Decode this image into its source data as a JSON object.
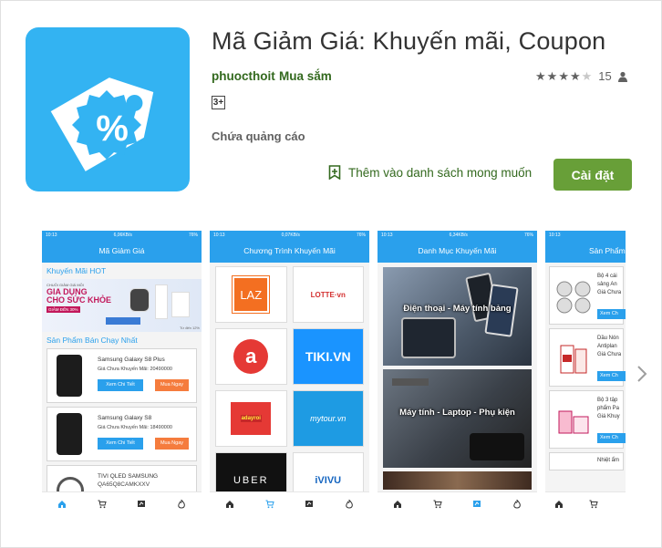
{
  "app": {
    "title": "Mã Giảm Giá: Khuyến mãi, Coupon",
    "developer": "phuocthoit",
    "category": "Mua sắm",
    "content_rating": "3+",
    "ads_notice": "Chứa quảng cáo",
    "rating_value": 4,
    "rating_max": 5,
    "rating_count": "15",
    "wishlist_label": "Thêm vào danh sách mong muốn",
    "install_label": "Cài đặt",
    "colors": {
      "accent": "#689f38",
      "link": "#33691e",
      "icon_bg": "#33b3f2",
      "app_bar": "#2aa0ec"
    }
  },
  "screenshots": {
    "status_time": "10:13",
    "s1": {
      "status_net": "6,06KB/s",
      "status_batt": "76%",
      "title": "Mã Giảm Giá",
      "section1": "Khuyến Mãi HOT",
      "banner_small": "CHUỖI GIẢM GIÁ MỖI",
      "banner_line1": "GIA DỤNG",
      "banner_line2": "CHO SỨC KHỎE",
      "banner_tag": "GIẢM ĐẾN 30%",
      "banner_corner": "Từ đến 12%",
      "section2": "Sản Phẩm Bán Chạy Nhất",
      "products": [
        {
          "name": "Samsung Galaxy S8 Plus",
          "price_label": "Giá Chưa Khuyến Mãi:",
          "price": "20490000",
          "detail": "Xem Chi Tiết",
          "buy": "Mua Ngay"
        },
        {
          "name": "Samsung Galaxy S8",
          "price_label": "Giá Chưa Khuyến Mãi:",
          "price": "18490000",
          "detail": "Xem Chi Tiết",
          "buy": "Mua Ngay"
        },
        {
          "name": "TIVI QLED SAMSUNG",
          "name2": "QA65Q8CAMKXXV"
        }
      ]
    },
    "s2": {
      "status_net": "0,07KB/s",
      "status_batt": "76%",
      "title": "Chương Trình Khuyến Mãi",
      "shops": [
        "LAZ",
        "LOTTE·vn",
        "a",
        "TIKI.VN",
        "adayroi",
        "mytour.vn",
        "UBER",
        "iVIVU"
      ]
    },
    "s3": {
      "status_net": "6,34KB/s",
      "status_batt": "76%",
      "title": "Danh Mục Khuyến Mãi",
      "categories": [
        "Điện thoại - Máy tính bảng",
        "Máy tính - Laptop - Phụ kiện"
      ]
    },
    "s4": {
      "title": "Sản Phẩm",
      "items": [
        {
          "l1": "Bộ 4 cái",
          "l2": "sảng An",
          "l3": "Giá Chưa",
          "btn": "Xem Ch"
        },
        {
          "l1": "Dầu Nón",
          "l2": "Antiplan",
          "l3": "Giá Chưa",
          "btn": "Xem Ch"
        },
        {
          "l1": "Bộ 3 tập",
          "l2": "phẩm Pa",
          "l3": "Giá Khuy",
          "btn": "Xem Ch"
        },
        {
          "l1": "Nhiệt ẩm"
        }
      ]
    }
  }
}
